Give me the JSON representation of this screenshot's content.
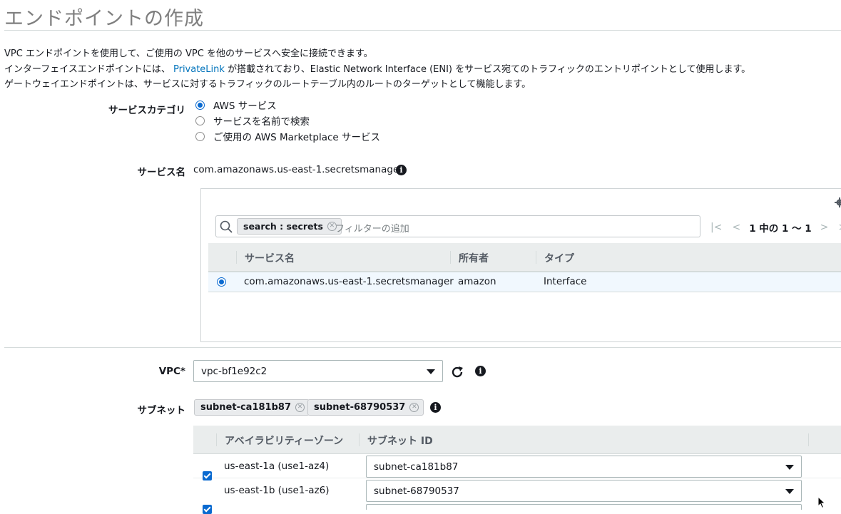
{
  "page": {
    "title": "エンドポイントの作成",
    "desc_line1": "VPC エンドポイントを使用して、ご使用の VPC を他のサービスへ安全に接続できます。",
    "desc_line2_pre": "インターフェイスエンドポイントには、",
    "desc_line2_link": "PrivateLink",
    "desc_line2_post": "が搭載されており、Elastic Network Interface (ENI) をサービス宛てのトラフィックのエントリポイントとして使用します。",
    "desc_line3": "ゲートウェイエンドポイントは、サービスに対するトラフィックのルートテーブル内のルートのターゲットとして機能します。"
  },
  "service_category": {
    "label": "サービスカテゴリ",
    "options": [
      {
        "label": "AWS サービス",
        "checked": true
      },
      {
        "label": "サービスを名前で検索",
        "checked": false
      },
      {
        "label": "ご使用の AWS Marketplace サービス",
        "checked": false
      }
    ]
  },
  "service_name": {
    "label": "サービス名",
    "value": "com.amazonaws.us-east-1.secretsmanager"
  },
  "service_table": {
    "search_token": "search : secrets",
    "filter_placeholder": "フィルターの追加",
    "pagination": "1 中の 1 〜 1",
    "columns": [
      "サービス名",
      "所有者",
      "タイプ"
    ],
    "rows": [
      {
        "service": "com.amazonaws.us-east-1.secretsmanager",
        "owner": "amazon",
        "type": "Interface",
        "selected": true
      }
    ]
  },
  "vpc": {
    "label": "VPC*",
    "value": "vpc-bf1e92c2"
  },
  "subnet": {
    "label": "サブネット",
    "tokens": [
      "subnet-ca181b87",
      "subnet-68790537"
    ],
    "columns": [
      "アベイラビリティーゾーン",
      "サブネット ID"
    ],
    "rows": [
      {
        "az": "us-east-1a (use1-az4)",
        "subnet": "subnet-ca181b87",
        "checked": true
      },
      {
        "az": "us-east-1b (use1-az6)",
        "subnet": "subnet-68790537",
        "checked": true
      }
    ]
  },
  "colors": {
    "link": "#0073bb",
    "radio_selected": "#0a6ad0",
    "checkbox": "#0a6ad0",
    "selected_row": "#f1f8fe",
    "header_bg": "#eaeded"
  }
}
